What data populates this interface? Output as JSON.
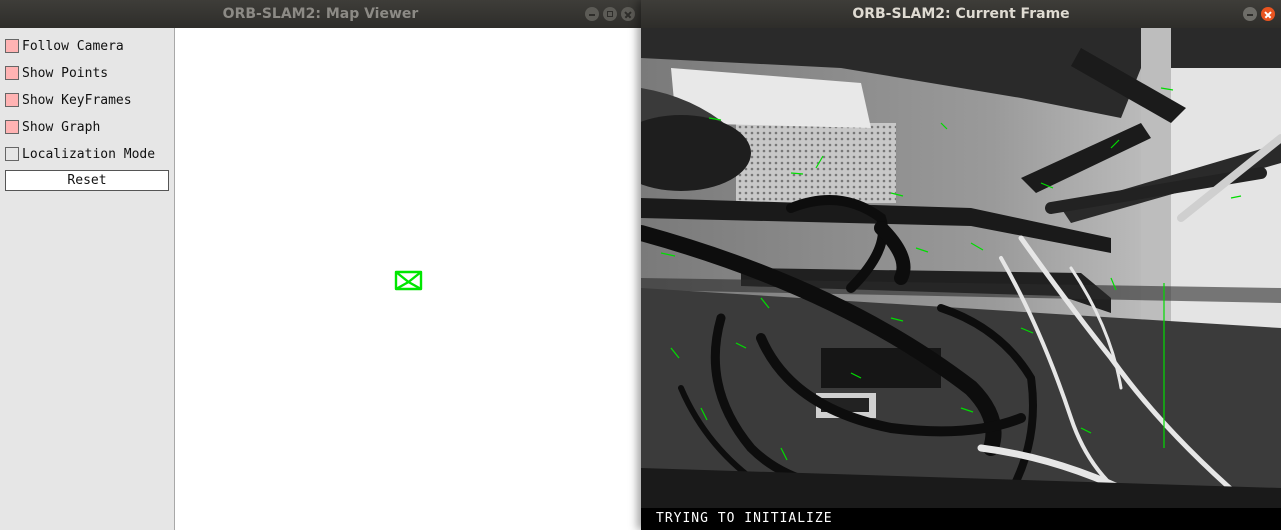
{
  "map_window": {
    "title": "ORB-SLAM2: Map Viewer",
    "panel": {
      "options": [
        {
          "label": "Follow Camera",
          "checked": true
        },
        {
          "label": "Show Points",
          "checked": true
        },
        {
          "label": "Show KeyFrames",
          "checked": true
        },
        {
          "label": "Show Graph",
          "checked": true
        },
        {
          "label": "Localization Mode",
          "checked": false
        }
      ],
      "reset_label": "Reset"
    }
  },
  "frame_window": {
    "title": "ORB-SLAM2: Current Frame",
    "status_text": "TRYING TO INITIALIZE"
  },
  "colors": {
    "checked_fill": "#ffb3b3",
    "camera_green": "#00e600",
    "accent_close": "#e95420"
  }
}
